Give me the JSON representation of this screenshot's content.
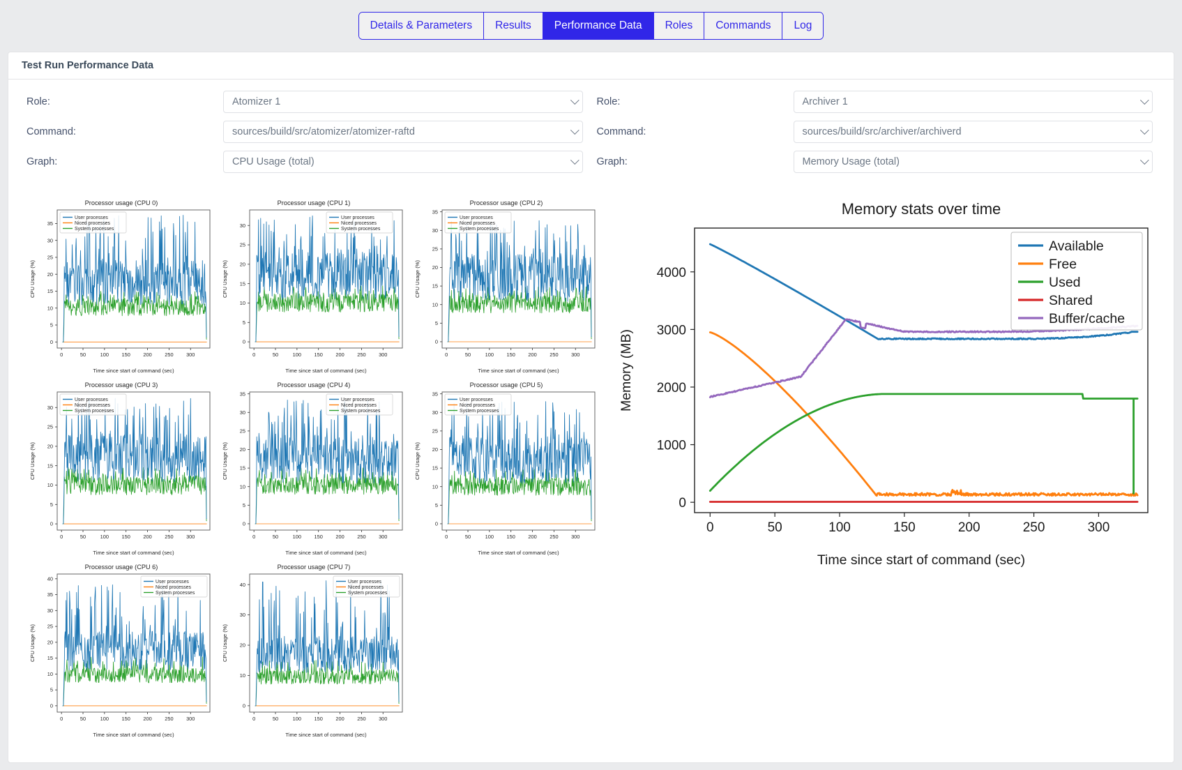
{
  "tabs": [
    {
      "label": "Details & Parameters",
      "active": false
    },
    {
      "label": "Results",
      "active": false
    },
    {
      "label": "Performance Data",
      "active": true
    },
    {
      "label": "Roles",
      "active": false
    },
    {
      "label": "Commands",
      "active": false
    },
    {
      "label": "Log",
      "active": false
    }
  ],
  "card": {
    "title": "Test Run Performance Data"
  },
  "form_left": {
    "role_label": "Role:",
    "role_value": "Atomizer 1",
    "command_label": "Command:",
    "command_value": "sources/build/src/atomizer/atomizer-raftd",
    "graph_label": "Graph:",
    "graph_value": "CPU Usage (total)"
  },
  "form_right": {
    "role_label": "Role:",
    "role_value": "Archiver 1",
    "command_label": "Command:",
    "command_value": "sources/build/src/archiver/archiverd",
    "graph_label": "Graph:",
    "graph_value": "Memory Usage (total)"
  },
  "colors": {
    "accent": "#3026e8",
    "blue": "#1f77b4",
    "orange": "#ff7f0e",
    "green": "#2ca02c",
    "red": "#d62728",
    "purple": "#9467bd",
    "page_bg": "#eaebed",
    "card_bg": "#ffffff"
  },
  "chart_data": [
    {
      "type": "line",
      "id": "cpu0",
      "title": "Processor usage (CPU 0)",
      "xlabel": "Time since start of command (sec)",
      "ylabel": "CPU Usage (%)",
      "xlim": [
        -10,
        345
      ],
      "ylim": [
        -1.8,
        39
      ],
      "xticks": [
        0,
        50,
        100,
        150,
        200,
        250,
        300
      ],
      "yticks": [
        0,
        5,
        10,
        15,
        20,
        25,
        30,
        35
      ],
      "legend_position": "upper left",
      "legend": [
        "User processes",
        "Niced processes",
        "System processes"
      ],
      "series": [
        {
          "name": "User processes",
          "color": "#1f77b4",
          "mean": 17.5,
          "amp": 7.0,
          "spike": 37.5,
          "seed": 11
        },
        {
          "name": "Niced processes",
          "color": "#ff7f0e",
          "mean": 0.0,
          "amp": 0.0,
          "spike": 0,
          "seed": 2
        },
        {
          "name": "System processes",
          "color": "#2ca02c",
          "mean": 10.2,
          "amp": 2.6,
          "spike": 15.0,
          "seed": 21
        }
      ]
    },
    {
      "type": "line",
      "id": "cpu1",
      "title": "Processor usage (CPU 1)",
      "xlabel": "Time since start of command (sec)",
      "ylabel": "CPU Usage (%)",
      "xlim": [
        -10,
        345
      ],
      "ylim": [
        -1.6,
        34
      ],
      "xticks": [
        0,
        50,
        100,
        150,
        200,
        250,
        300
      ],
      "yticks": [
        0,
        5,
        10,
        15,
        20,
        25,
        30
      ],
      "legend_position": "upper center",
      "legend": [
        "User processes",
        "Niced processes",
        "System processes"
      ],
      "series": [
        {
          "name": "User processes",
          "color": "#1f77b4",
          "mean": 17.0,
          "amp": 6.5,
          "spike": 32.5,
          "seed": 31
        },
        {
          "name": "Niced processes",
          "color": "#ff7f0e",
          "mean": 0.0,
          "amp": 0.0,
          "spike": 0,
          "seed": 3
        },
        {
          "name": "System processes",
          "color": "#2ca02c",
          "mean": 10.0,
          "amp": 2.5,
          "spike": 14.5,
          "seed": 41
        }
      ]
    },
    {
      "type": "line",
      "id": "cpu2",
      "title": "Processor usage (CPU 2)",
      "xlabel": "Time since start of command (sec)",
      "ylabel": "CPU Usage (%)",
      "xlim": [
        -10,
        345
      ],
      "ylim": [
        -1.7,
        35.5
      ],
      "xticks": [
        0,
        50,
        100,
        150,
        200,
        250,
        300
      ],
      "yticks": [
        0,
        5,
        10,
        15,
        20,
        25,
        30,
        35
      ],
      "legend_position": "upper left",
      "legend": [
        "User processes",
        "Niced processes",
        "System processes"
      ],
      "series": [
        {
          "name": "User processes",
          "color": "#1f77b4",
          "mean": 17.2,
          "amp": 6.8,
          "spike": 33.6,
          "seed": 51
        },
        {
          "name": "Niced processes",
          "color": "#ff7f0e",
          "mean": 0.0,
          "amp": 0.0,
          "spike": 0,
          "seed": 4
        },
        {
          "name": "System processes",
          "color": "#2ca02c",
          "mean": 10.1,
          "amp": 2.5,
          "spike": 14.8,
          "seed": 61
        }
      ]
    },
    {
      "type": "line",
      "id": "cpu3",
      "title": "Processor usage (CPU 3)",
      "xlabel": "Time since start of command (sec)",
      "ylabel": "CPU Usage (%)",
      "xlim": [
        -10,
        345
      ],
      "ylim": [
        -1.6,
        34
      ],
      "xticks": [
        0,
        50,
        100,
        150,
        200,
        250,
        300
      ],
      "yticks": [
        0,
        5,
        10,
        15,
        20,
        25,
        30
      ],
      "legend_position": "upper left",
      "legend": [
        "User processes",
        "Niced processes",
        "System processes"
      ],
      "series": [
        {
          "name": "User processes",
          "color": "#1f77b4",
          "mean": 17.0,
          "amp": 6.6,
          "spike": 32.8,
          "seed": 71
        },
        {
          "name": "Niced processes",
          "color": "#ff7f0e",
          "mean": 0.0,
          "amp": 0.0,
          "spike": 0,
          "seed": 5
        },
        {
          "name": "System processes",
          "color": "#2ca02c",
          "mean": 9.9,
          "amp": 2.6,
          "spike": 14.6,
          "seed": 81
        }
      ]
    },
    {
      "type": "line",
      "id": "cpu4",
      "title": "Processor usage (CPU 4)",
      "xlabel": "Time since start of command (sec)",
      "ylabel": "CPU Usage (%)",
      "xlim": [
        -10,
        345
      ],
      "ylim": [
        -1.7,
        35.5
      ],
      "xticks": [
        0,
        50,
        100,
        150,
        200,
        250,
        300
      ],
      "yticks": [
        0,
        5,
        10,
        15,
        20,
        25,
        30,
        35
      ],
      "legend_position": "upper center",
      "legend": [
        "User processes",
        "Niced processes",
        "System processes"
      ],
      "series": [
        {
          "name": "User processes",
          "color": "#1f77b4",
          "mean": 17.4,
          "amp": 6.9,
          "spike": 33.4,
          "seed": 91
        },
        {
          "name": "Niced processes",
          "color": "#ff7f0e",
          "mean": 0.0,
          "amp": 0.0,
          "spike": 0,
          "seed": 6
        },
        {
          "name": "System processes",
          "color": "#2ca02c",
          "mean": 10.3,
          "amp": 2.6,
          "spike": 15.2,
          "seed": 101
        }
      ]
    },
    {
      "type": "line",
      "id": "cpu5",
      "title": "Processor usage (CPU 5)",
      "xlabel": "Time since start of command (sec)",
      "ylabel": "CPU Usage (%)",
      "xlim": [
        -10,
        345
      ],
      "ylim": [
        -1.7,
        35.5
      ],
      "xticks": [
        0,
        50,
        100,
        150,
        200,
        250,
        300
      ],
      "yticks": [
        0,
        5,
        10,
        15,
        20,
        25,
        30,
        35
      ],
      "legend_position": "upper left",
      "legend": [
        "User processes",
        "Niced processes",
        "System processes"
      ],
      "series": [
        {
          "name": "User processes",
          "color": "#1f77b4",
          "mean": 17.1,
          "amp": 6.7,
          "spike": 33.2,
          "seed": 111
        },
        {
          "name": "Niced processes",
          "color": "#ff7f0e",
          "mean": 0.0,
          "amp": 0.0,
          "spike": 0,
          "seed": 7
        },
        {
          "name": "System processes",
          "color": "#2ca02c",
          "mean": 10.0,
          "amp": 2.5,
          "spike": 14.7,
          "seed": 121
        }
      ]
    },
    {
      "type": "line",
      "id": "cpu6",
      "title": "Processor usage (CPU 6)",
      "xlabel": "Time since start of command (sec)",
      "ylabel": "CPU Usage (%)",
      "xlim": [
        -10,
        345
      ],
      "ylim": [
        -2.0,
        41.5
      ],
      "xticks": [
        0,
        50,
        100,
        150,
        200,
        250,
        300
      ],
      "yticks": [
        0,
        5,
        10,
        15,
        20,
        25,
        30,
        35,
        40
      ],
      "legend_position": "upper right",
      "legend": [
        "User processes",
        "Niced processes",
        "System processes"
      ],
      "series": [
        {
          "name": "User processes",
          "color": "#1f77b4",
          "mean": 17.3,
          "amp": 6.5,
          "spike": 39.2,
          "seed": 131
        },
        {
          "name": "Niced processes",
          "color": "#ff7f0e",
          "mean": 0.0,
          "amp": 0.0,
          "spike": 0,
          "seed": 8
        },
        {
          "name": "System processes",
          "color": "#2ca02c",
          "mean": 9.6,
          "amp": 2.5,
          "spike": 15.4,
          "seed": 141
        }
      ]
    },
    {
      "type": "line",
      "id": "cpu7",
      "title": "Processor usage (CPU 7)",
      "xlabel": "Time since start of command (sec)",
      "ylabel": "CPU Usage (%)",
      "xlim": [
        -10,
        345
      ],
      "ylim": [
        -2.1,
        43.5
      ],
      "xticks": [
        0,
        50,
        100,
        150,
        200,
        250,
        300
      ],
      "yticks": [
        0,
        10,
        20,
        30,
        40
      ],
      "legend_position": "upper right",
      "legend": [
        "User processes",
        "Niced processes",
        "System processes"
      ],
      "series": [
        {
          "name": "User processes",
          "color": "#1f77b4",
          "mean": 17.0,
          "amp": 6.4,
          "spike": 41.5,
          "seed": 151
        },
        {
          "name": "Niced processes",
          "color": "#ff7f0e",
          "mean": 0.0,
          "amp": 0.0,
          "spike": 0,
          "seed": 9
        },
        {
          "name": "System processes",
          "color": "#2ca02c",
          "mean": 9.4,
          "amp": 2.4,
          "spike": 15.0,
          "seed": 161
        }
      ]
    },
    {
      "type": "line",
      "id": "memory",
      "title": "Memory stats over time",
      "xlabel": "Time since start of command (sec)",
      "ylabel": "Memory (MB)",
      "xlim": [
        -12,
        338
      ],
      "ylim": [
        -180,
        4760
      ],
      "xticks": [
        0,
        50,
        100,
        150,
        200,
        250,
        300
      ],
      "yticks": [
        0,
        1000,
        2000,
        3000,
        4000
      ],
      "legend_position": "upper right",
      "legend": [
        "Available",
        "Free",
        "Used",
        "Shared",
        "Buffer/cache"
      ],
      "series": [
        {
          "name": "Available",
          "color": "#1f77b4",
          "start": 4480,
          "end": 2950,
          "knee": 130,
          "plateau": 2830,
          "tail": 2960,
          "noise": 12,
          "shape": "decay"
        },
        {
          "name": "Free",
          "color": "#ff7f0e",
          "start": 2950,
          "end": 130,
          "knee": 128,
          "plateau": 130,
          "tail": 150,
          "noise": 22,
          "shape": "drop"
        },
        {
          "name": "Used",
          "color": "#2ca02c",
          "start": 200,
          "end": 1800,
          "knee": 135,
          "plateau": 1880,
          "tail": 1800,
          "noise": 8,
          "shape": "rise"
        },
        {
          "name": "Shared",
          "color": "#d62728",
          "start": 8,
          "end": 8,
          "knee": 0,
          "plateau": 8,
          "tail": 8,
          "noise": 0,
          "shape": "flat"
        },
        {
          "name": "Buffer/cache",
          "color": "#9467bd",
          "start": 1830,
          "end": 3060,
          "knee": 70,
          "plateau": 2960,
          "tail": 3060,
          "noise": 20,
          "shape": "ramp"
        }
      ]
    }
  ]
}
